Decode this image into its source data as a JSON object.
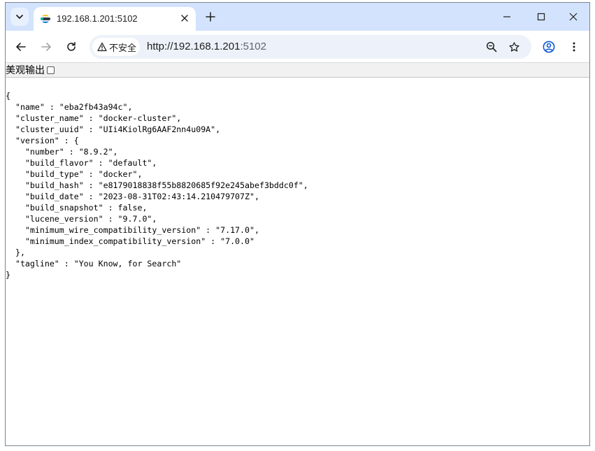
{
  "browser": {
    "tab": {
      "title": "192.168.1.201:5102",
      "favicon": "elasticsearch-icon"
    },
    "tab_search_icon": "chevron-down-icon",
    "new_tab_icon": "plus-icon",
    "window_controls": [
      "minimize-icon",
      "maximize-icon",
      "close-icon"
    ],
    "nav": {
      "back_icon": "arrow-left-icon",
      "forward_icon": "arrow-right-icon",
      "reload_icon": "reload-icon"
    },
    "omnibox": {
      "security_label": "不安全",
      "security_icon": "warning-icon",
      "url_host": "http://192.168.1.201",
      "url_port": ":5102",
      "zoom_icon": "zoom-out-icon",
      "bookmark_icon": "star-icon"
    },
    "profile_icon": "profile-icon",
    "menu_icon": "more-vert-icon"
  },
  "page": {
    "pretty_print_label": "美观输出",
    "pretty_print_checked": false,
    "json_lines": [
      "{",
      "  \"name\" : \"eba2fb43a94c\",",
      "  \"cluster_name\" : \"docker-cluster\",",
      "  \"cluster_uuid\" : \"UIi4KiolRg6AAF2nn4u09A\",",
      "  \"version\" : {",
      "    \"number\" : \"8.9.2\",",
      "    \"build_flavor\" : \"default\",",
      "    \"build_type\" : \"docker\",",
      "    \"build_hash\" : \"e8179018838f55b8820685f92e245abef3bddc0f\",",
      "    \"build_date\" : \"2023-08-31T02:43:14.210479707Z\",",
      "    \"build_snapshot\" : false,",
      "    \"lucene_version\" : \"9.7.0\",",
      "    \"minimum_wire_compatibility_version\" : \"7.17.0\",",
      "    \"minimum_index_compatibility_version\" : \"7.0.0\"",
      "  },",
      "  \"tagline\" : \"You Know, for Search\"",
      "}"
    ]
  },
  "colors": {
    "tabstrip": "#d3e3fd",
    "omnibox": "#edf2fa",
    "profile": "#0b57d0"
  }
}
